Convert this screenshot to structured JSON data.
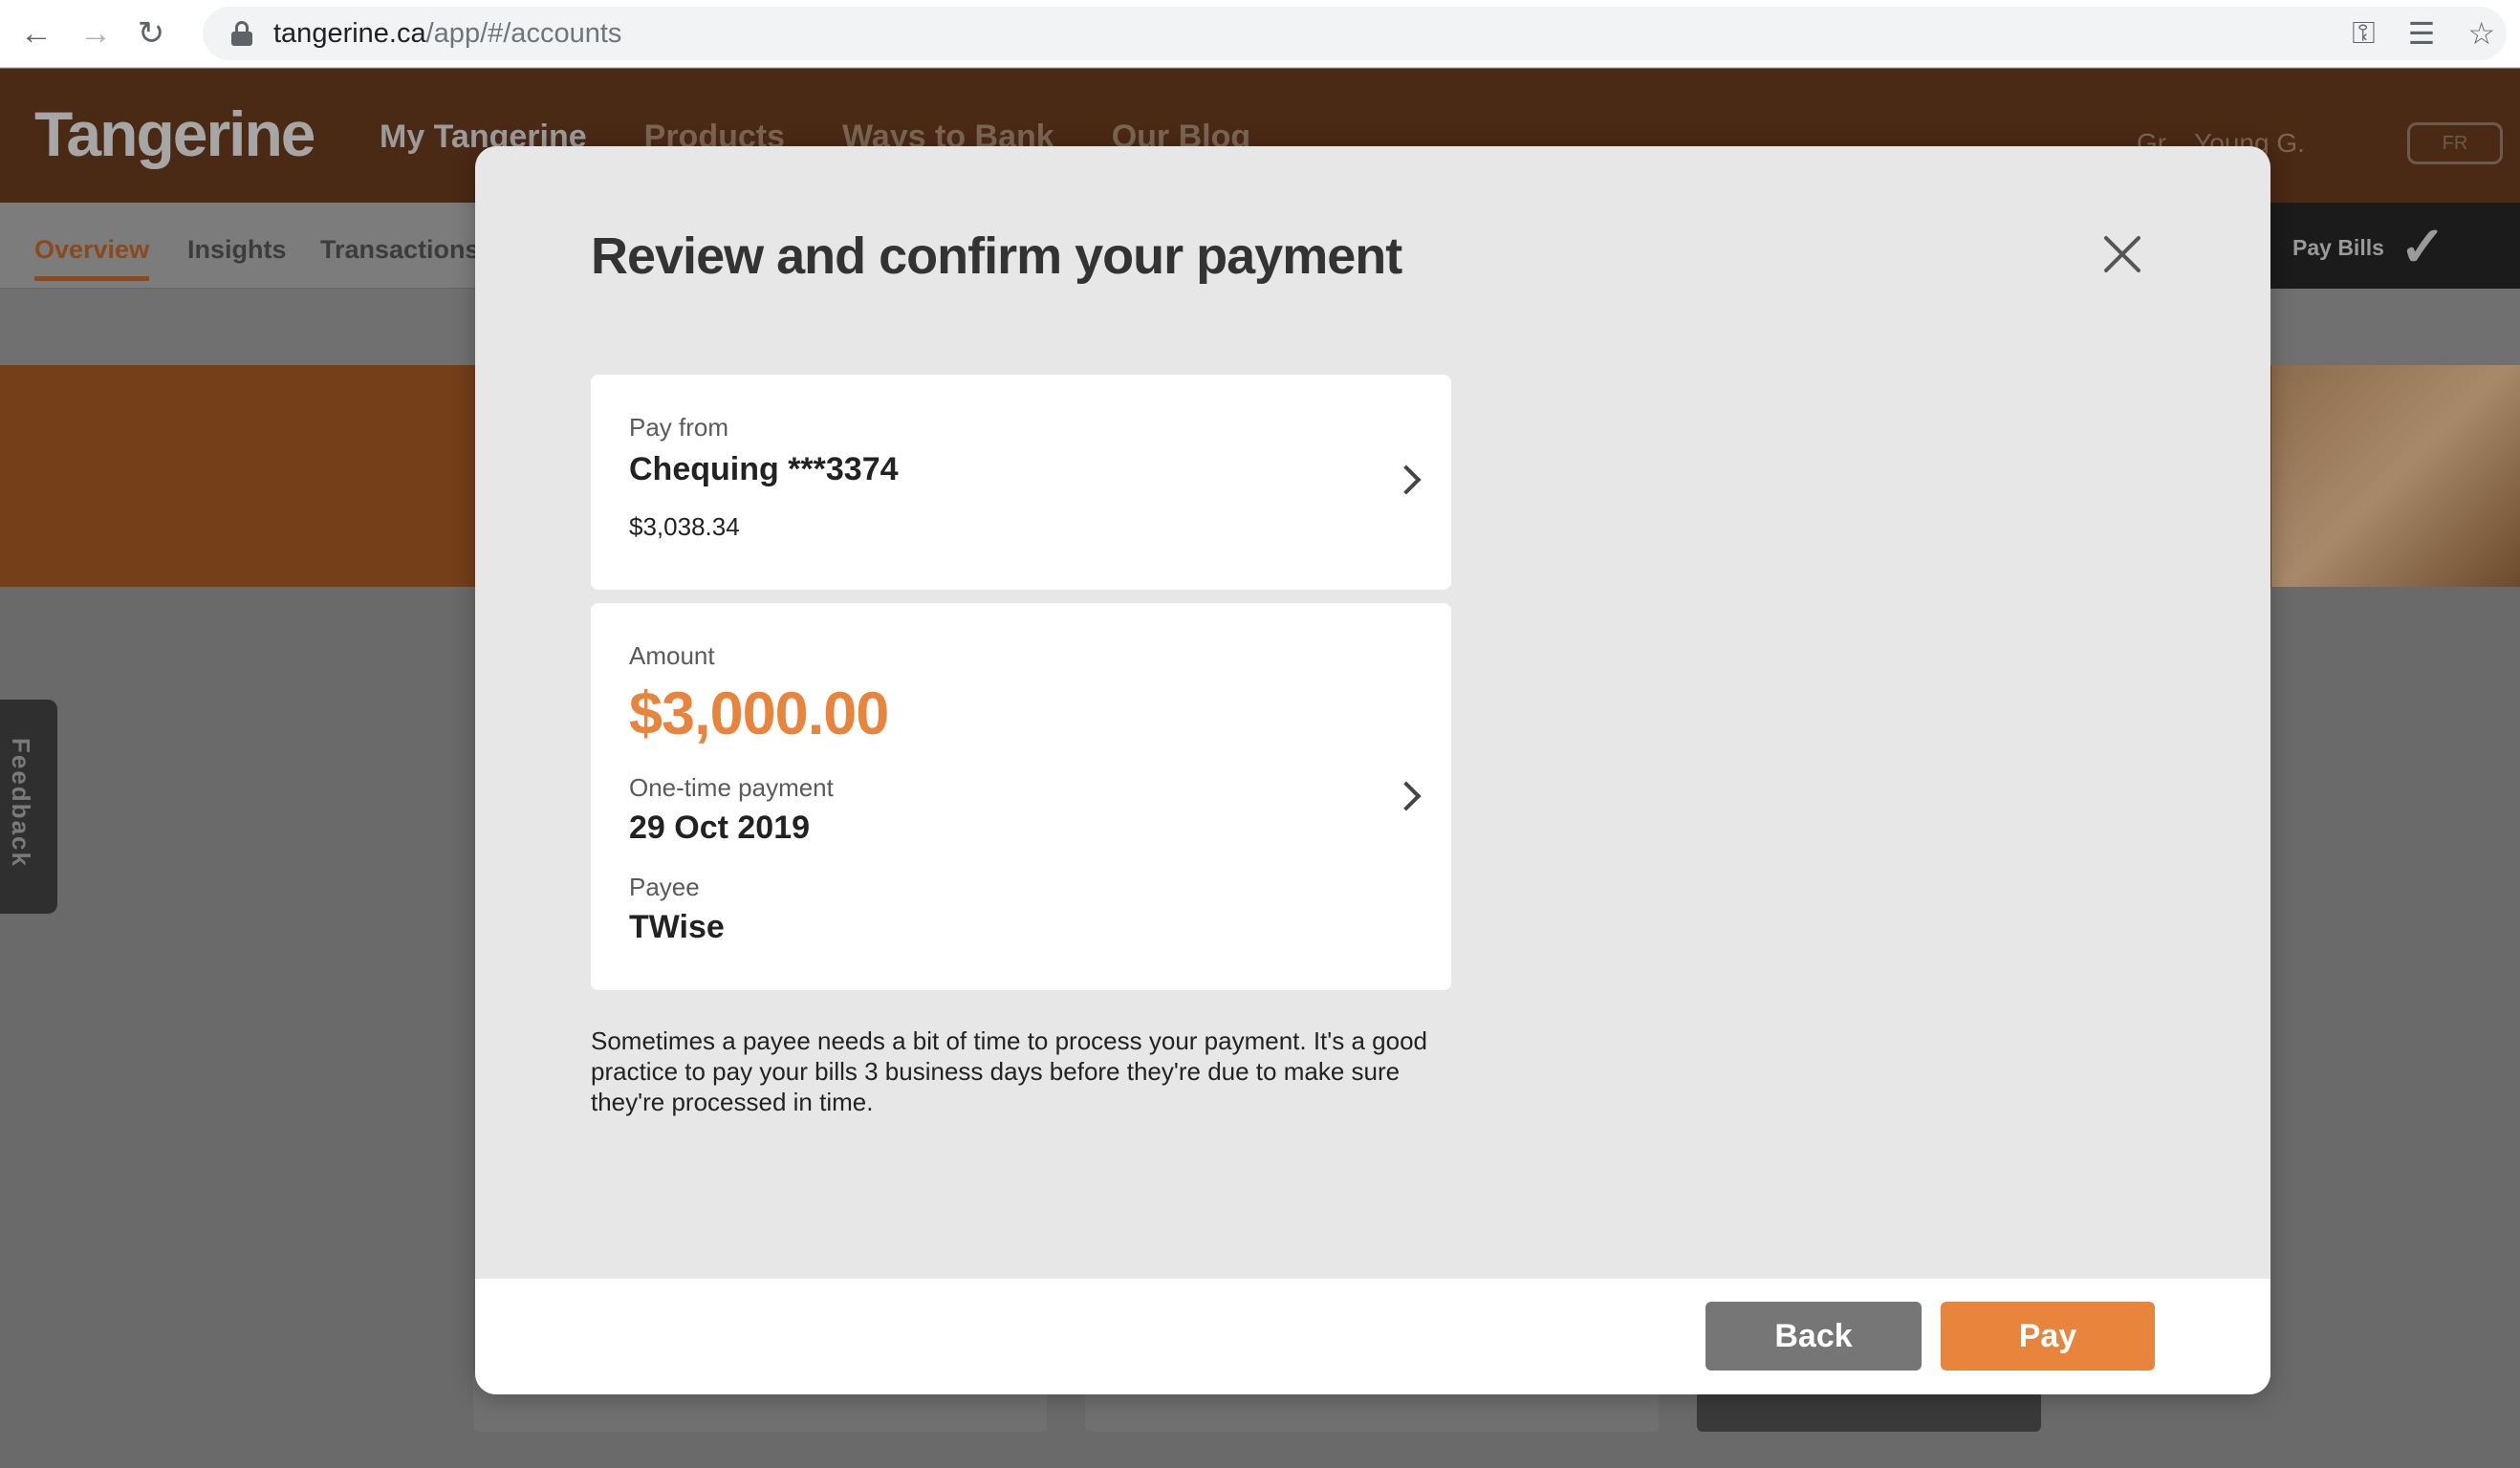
{
  "browser": {
    "url_host": "tangerine.ca",
    "url_path": "/app/#/accounts"
  },
  "site": {
    "logo": "Tangerine",
    "nav": [
      "My Tangerine",
      "Products",
      "Ways to Bank",
      "Our Blog"
    ],
    "user": "Gr... Young G.",
    "lang_button": "FR",
    "subnav": [
      "Overview",
      "Insights",
      "Transactions"
    ],
    "pay_bills_label": "Pay Bills",
    "feedback": "Feedback"
  },
  "modal": {
    "title": "Review and confirm your payment",
    "pay_from": {
      "label": "Pay from",
      "account": "Chequing ***3374",
      "balance": "$3,038.34"
    },
    "details": {
      "amount_label": "Amount",
      "amount": "$3,000.00",
      "frequency_label": "One-time payment",
      "date": "29 Oct 2019",
      "payee_label": "Payee",
      "payee": "TWise"
    },
    "note": "Sometimes a payee needs a bit of time to process your payment. It's a good practice to pay your bills 3 business days before they're due to make sure they're processed in time.",
    "back_label": "Back",
    "pay_label": "Pay"
  },
  "colors": {
    "accent": "#e8843c",
    "back_button": "#767676"
  }
}
